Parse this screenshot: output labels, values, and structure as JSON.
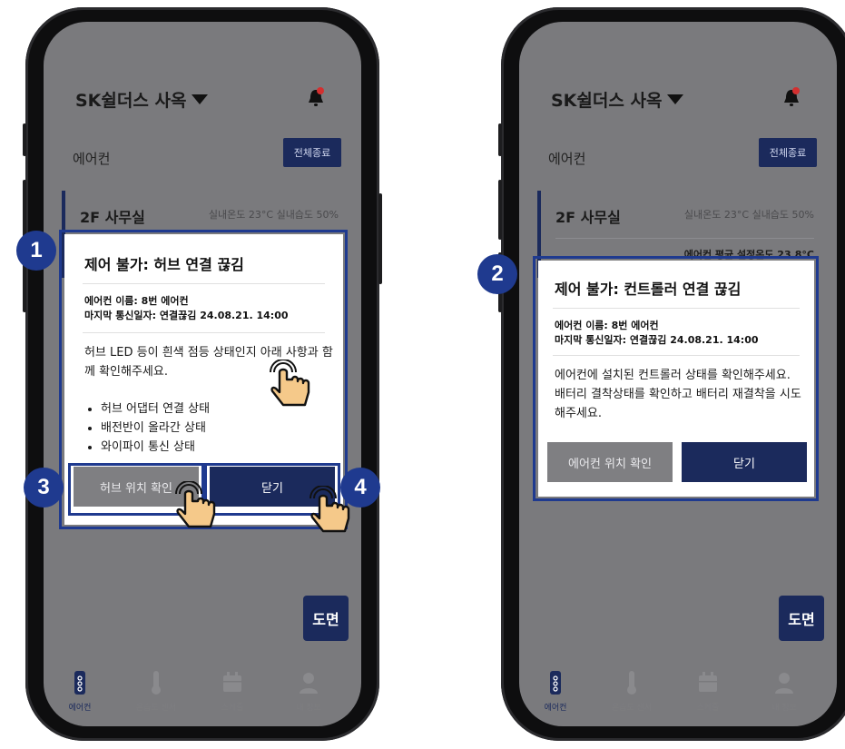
{
  "colors": {
    "navy": "#1b2a5c",
    "badge_blue": "#1f3a8f",
    "dim_overlay": "#7a7a7d",
    "bell_dot": "#d32f2f",
    "hand_fill": "#f5c98a"
  },
  "left_phone": {
    "header": {
      "site_name": "SK쉴더스 사옥"
    },
    "section": {
      "title": "에어컨",
      "all_off_button": "전체종료"
    },
    "room": {
      "name": "2F 사무실",
      "env": "실내온도 23°C  실내습도 50%"
    },
    "modal": {
      "title": "제어 불가: 허브 연결 끊김",
      "info_name": "에어컨 이름: 8번 에어컨",
      "info_last": "마지막 통신일자: 연결끊김 24.08.21. 14:00",
      "description": "허브 LED 등이 흰색 점등 상태인지 아래 사항과 함께 확인해주세요.",
      "bullets": [
        "허브 어댑터 연결 상태",
        "배전반이 올라간 상태",
        "와이파이 통신 상태"
      ],
      "primary_button": "허브 위치 확인",
      "close_button": "닫기"
    },
    "plan_button": "도면",
    "nav": [
      "에어컨",
      "온습도 센서",
      "스케줄",
      "내 정보"
    ],
    "badges": [
      "1",
      "3",
      "4"
    ]
  },
  "right_phone": {
    "header": {
      "site_name": "SK쉴더스 사옥"
    },
    "section": {
      "title": "에어컨",
      "all_off_button": "전체종료"
    },
    "room": {
      "name": "2F 사무실",
      "env": "실내온도 23°C  실내습도 50%",
      "avg": "에어컨 평균 설정온도 23.8°C"
    },
    "modal": {
      "title": "제어 불가: 컨트롤러 연결 끊김",
      "info_name": "에어컨 이름: 8번 에어컨",
      "info_last": "마지막 통신일자: 연결끊김 24.08.21. 14:00",
      "description": "에어컨에 설치된 컨트롤러 상태를 확인해주세요. 배터리 결착상태를 확인하고 배터리 재결착을 시도해주세요.",
      "primary_button": "에어컨 위치 확인",
      "close_button": "닫기"
    },
    "plan_button": "도면",
    "nav": [
      "에어컨",
      "온습도 센서",
      "스케줄",
      "내 정보"
    ],
    "badges": [
      "2"
    ]
  }
}
